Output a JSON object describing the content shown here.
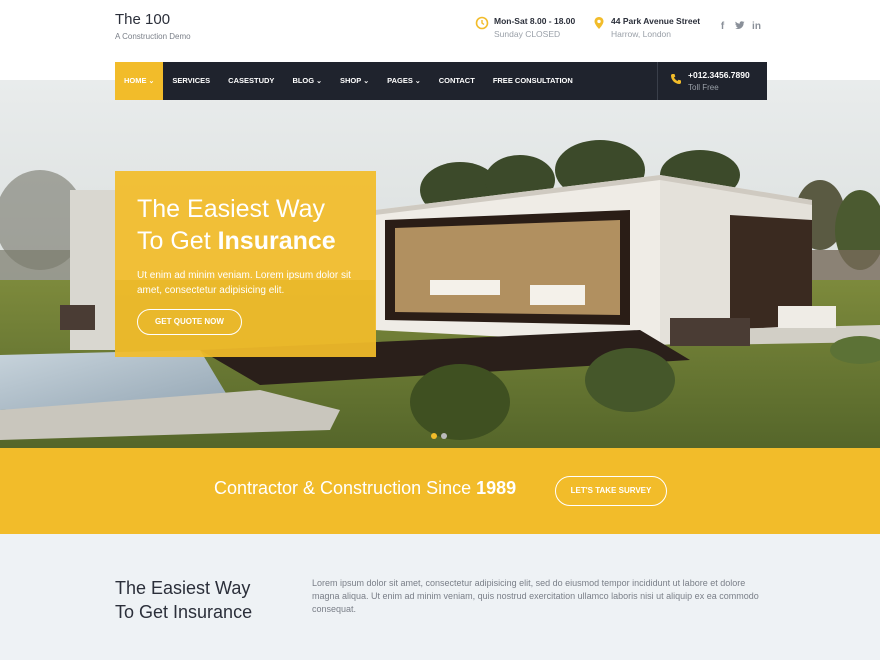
{
  "brand": {
    "title": "The 100",
    "subtitle": "A Construction Demo"
  },
  "contact": {
    "hours_main": "Mon-Sat 8.00 - 18.00",
    "hours_sub": "Sunday CLOSED",
    "address_main": "44 Park Avenue Street",
    "address_sub": "Harrow, London",
    "hours_icon": "clock-icon",
    "address_icon": "location-pin-icon"
  },
  "social": {
    "facebook": "f",
    "twitter": "t",
    "linkedin": "in"
  },
  "nav": {
    "items": [
      {
        "label": "HOME",
        "caret": "⌄"
      },
      {
        "label": "SERVICES",
        "caret": ""
      },
      {
        "label": "CASESTUDY",
        "caret": ""
      },
      {
        "label": "BLOG",
        "caret": "⌄"
      },
      {
        "label": "SHOP",
        "caret": "⌄"
      },
      {
        "label": "PAGES",
        "caret": "⌄"
      },
      {
        "label": "CONTACT",
        "caret": ""
      },
      {
        "label": "FREE CONSULTATION",
        "caret": ""
      }
    ],
    "phone": "+012.3456.7890",
    "phone_sub": "Toll Free",
    "phone_icon": "phone-icon"
  },
  "hero": {
    "title_line1": "The Easiest Way",
    "title_line2_prefix": "To Get ",
    "title_line2_bold": "Insurance",
    "text": "Ut enim ad minim veniam. Lorem ipsum dolor sit amet, consectetur adipisicing elit.",
    "button": "GET QUOTE NOW"
  },
  "band": {
    "text": "Contractor & Construction Since ",
    "year": "1989",
    "button": "LET'S TAKE SURVEY"
  },
  "lower": {
    "heading_line1": "The Easiest Way",
    "heading_line2": "To Get Insurance",
    "text": "Lorem ipsum dolor sit amet, consectetur adipisicing elit, sed do eiusmod tempor incididunt ut labore et dolore magna aliqua. Ut enim ad minim veniam, quis nostrud exercitation ullamco laboris nisi ut aliquip ex ea commodo consequat."
  },
  "colors": {
    "accent": "#f2bc2a",
    "dark": "#1f232d",
    "lower_bg": "#eef2f5"
  }
}
